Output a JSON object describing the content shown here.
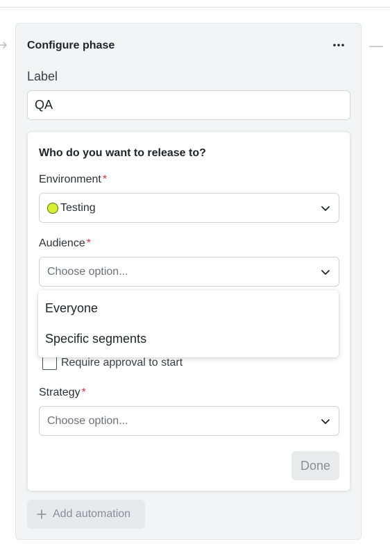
{
  "phase": {
    "title": "Configure phase",
    "more_label": "···",
    "label_caption": "Label",
    "label_value": "QA"
  },
  "release": {
    "heading": "Who do you want to release to?",
    "environment": {
      "label": "Environment",
      "required_mark": "*",
      "value": "Testing",
      "dot_color": "#d6f02d"
    },
    "audience": {
      "label": "Audience",
      "required_mark": "*",
      "placeholder": "Choose option...",
      "options": [
        "Everyone",
        "Specific segments"
      ]
    },
    "approval": {
      "label": "Require approval to start",
      "checked": false
    },
    "strategy": {
      "label": "Strategy",
      "required_mark": "*",
      "placeholder": "Choose option..."
    },
    "done_label": "Done"
  },
  "automation": {
    "add_label": "Add automation"
  },
  "colors": {
    "required": "#d9303e",
    "card_bg": "#f3f4f6",
    "disabled_text": "#8a8f97"
  }
}
